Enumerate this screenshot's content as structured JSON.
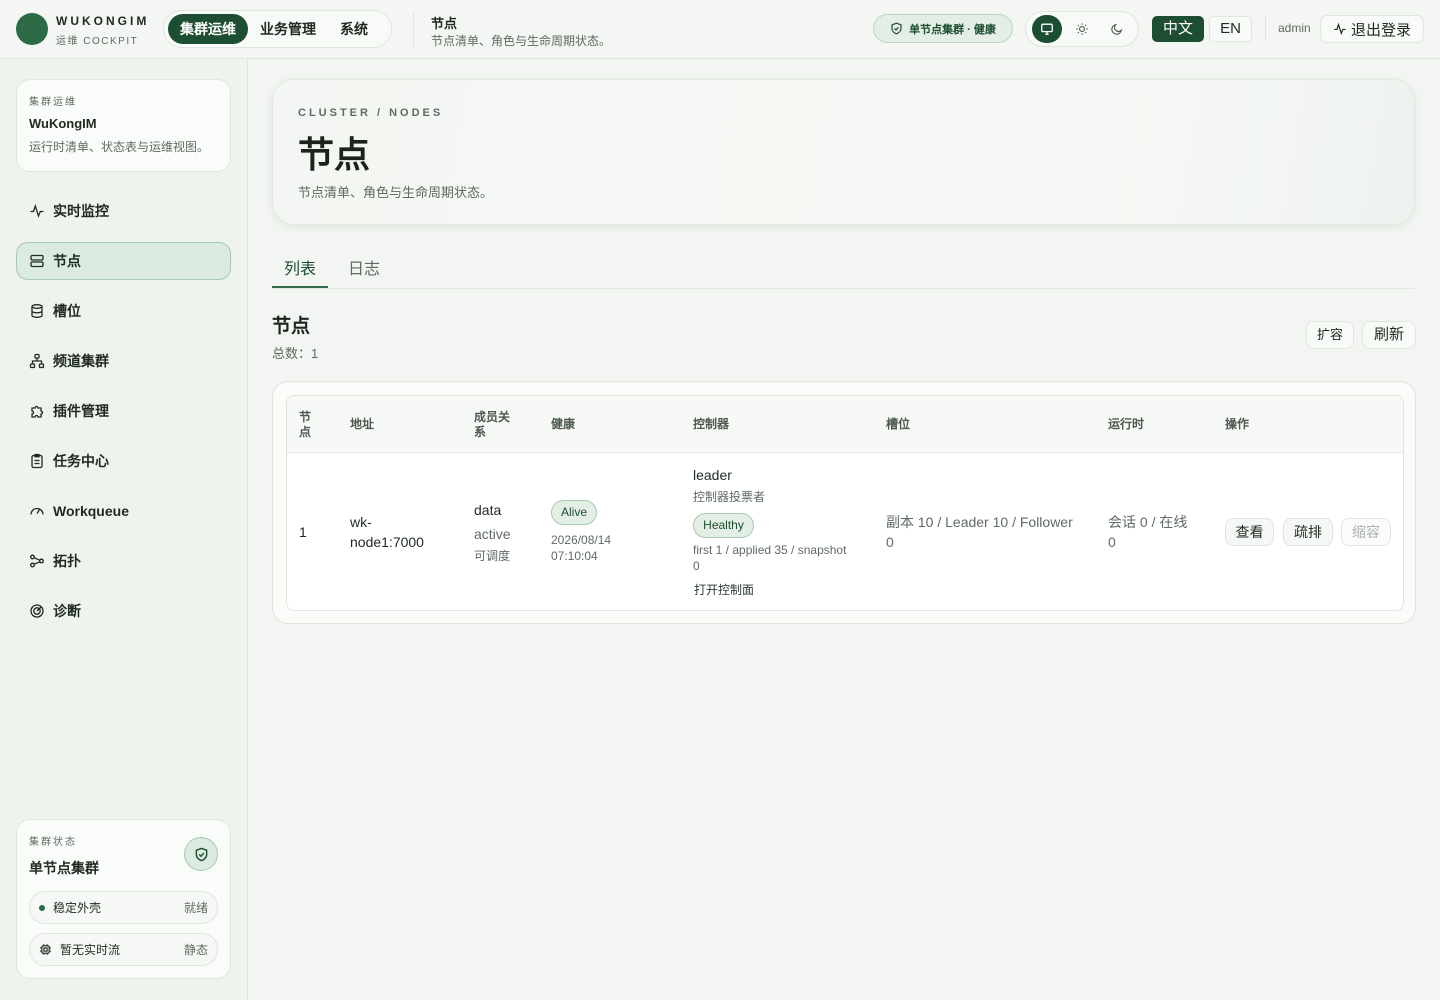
{
  "brand": {
    "name": "WUKONGIM",
    "subtitle": "运维 COCKPIT"
  },
  "main_nav": [
    {
      "label": "集群运维",
      "active": true
    },
    {
      "label": "业务管理",
      "active": false
    },
    {
      "label": "系统",
      "active": false
    }
  ],
  "page_header": {
    "title": "节点",
    "subtitle": "节点清单、角色与生命周期状态。"
  },
  "health_chip": "单节点集群 · 健康",
  "theme_buttons": [
    {
      "icon": "monitor-icon",
      "active": true
    },
    {
      "icon": "sun-icon",
      "active": false
    },
    {
      "icon": "moon-icon",
      "active": false
    }
  ],
  "lang": {
    "zh": "中文",
    "en": "EN"
  },
  "user": {
    "name": "admin",
    "logout": "退出登录"
  },
  "workspace": {
    "eyebrow": "集群运维",
    "name": "WuKongIM",
    "description": "运行时清单、状态表与运维视图。"
  },
  "sidebar": {
    "items": [
      {
        "label": "实时监控",
        "icon": "activity-icon",
        "active": false
      },
      {
        "label": "节点",
        "icon": "server-icon",
        "active": true
      },
      {
        "label": "槽位",
        "icon": "database-icon",
        "active": false
      },
      {
        "label": "频道集群",
        "icon": "network-icon",
        "active": false
      },
      {
        "label": "插件管理",
        "icon": "puzzle-icon",
        "active": false
      },
      {
        "label": "任务中心",
        "icon": "clipboard-icon",
        "active": false
      },
      {
        "label": "Workqueue",
        "icon": "gauge-icon",
        "active": false
      },
      {
        "label": "拓扑",
        "icon": "topology-icon",
        "active": false
      },
      {
        "label": "诊断",
        "icon": "radar-icon",
        "active": false
      }
    ]
  },
  "cluster_status": {
    "eyebrow": "集群状态",
    "title": "单节点集群",
    "rows": [
      {
        "label": "稳定外壳",
        "value": "就绪",
        "icon": "status-dot"
      },
      {
        "label": "暂无实时流",
        "value": "静态",
        "icon": "chip-icon"
      }
    ]
  },
  "hero": {
    "crumb": "CLUSTER / NODES",
    "title": "节点",
    "description": "节点清单、角色与生命周期状态。"
  },
  "tabs": [
    {
      "label": "列表",
      "active": true
    },
    {
      "label": "日志",
      "active": false
    }
  ],
  "section": {
    "title": "节点",
    "count_label": "总数：1",
    "scale_out": "扩容",
    "refresh": "刷新"
  },
  "table": {
    "headers": [
      "节\n点",
      "地址",
      "成员关\n系",
      "健康",
      "控制器",
      "槽位",
      "运行时",
      "操作"
    ],
    "rows": [
      {
        "node": "1",
        "address": "wk-\nnode1:7000",
        "membership": {
          "role": "data",
          "state": "active",
          "note": "可调度"
        },
        "health": {
          "status": "Alive",
          "time": "2026/08/14\n07:10:04"
        },
        "controller": {
          "role": "leader",
          "desc": "控制器投票者",
          "health": "Healthy",
          "raft": "first 1 / applied 35 / snapshot\n0",
          "link": "打开控制面"
        },
        "slots": "副本 10 / Leader 10 / Follower\n0",
        "runtime": "会话 0 / 在线\n0",
        "actions": {
          "view": "查看",
          "drain": "疏排",
          "scale_in": "缩容"
        }
      }
    ]
  },
  "colors": {
    "accent": "#1d4d33",
    "brand": "#2d6a46",
    "background": "#f2f5f1"
  }
}
